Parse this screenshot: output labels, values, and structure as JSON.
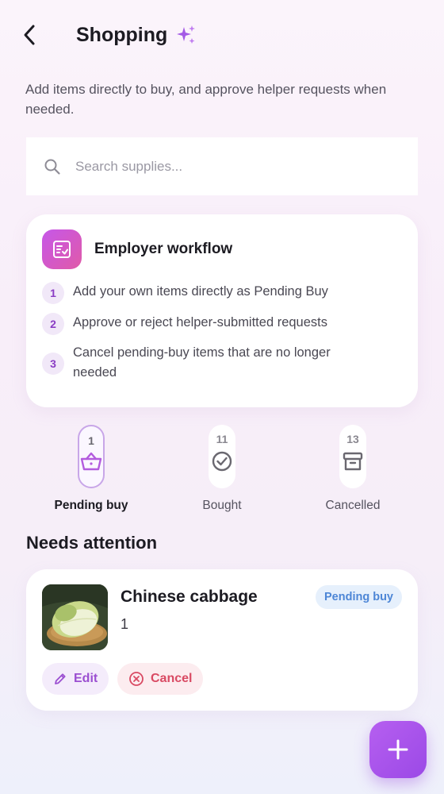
{
  "header": {
    "title": "Shopping",
    "back_icon": "chevron-left-icon",
    "sparkle_icon": "sparkle-icon"
  },
  "subtitle": "Add items directly to buy, and approve helper requests when needed.",
  "search": {
    "placeholder": "Search supplies...",
    "value": ""
  },
  "workflow": {
    "title": "Employer workflow",
    "icon": "checklist-icon",
    "steps": [
      {
        "number": "1",
        "text": "Add your own items directly as Pending Buy"
      },
      {
        "number": "2",
        "text": "Approve or reject helper-submitted requests"
      },
      {
        "number": "3",
        "text": "Cancel pending-buy items that are no longer needed"
      }
    ]
  },
  "tabs": [
    {
      "label": "Pending buy",
      "count": "1",
      "icon": "basket-icon",
      "active": true
    },
    {
      "label": "Bought",
      "count": "11",
      "icon": "check-circle-icon",
      "active": false
    },
    {
      "label": "Cancelled",
      "count": "13",
      "icon": "archive-box-icon",
      "active": false
    }
  ],
  "section": {
    "title": "Needs attention"
  },
  "items": [
    {
      "name": "Chinese cabbage",
      "quantity": "1",
      "status": "Pending buy",
      "edit_label": "Edit",
      "cancel_label": "Cancel"
    }
  ],
  "fab": {
    "icon": "plus-icon"
  },
  "colors": {
    "accent": "#9b49e6",
    "badge_text": "#4d86d6",
    "badge_bg": "#e6f0fc",
    "cancel_text": "#d94a63"
  }
}
